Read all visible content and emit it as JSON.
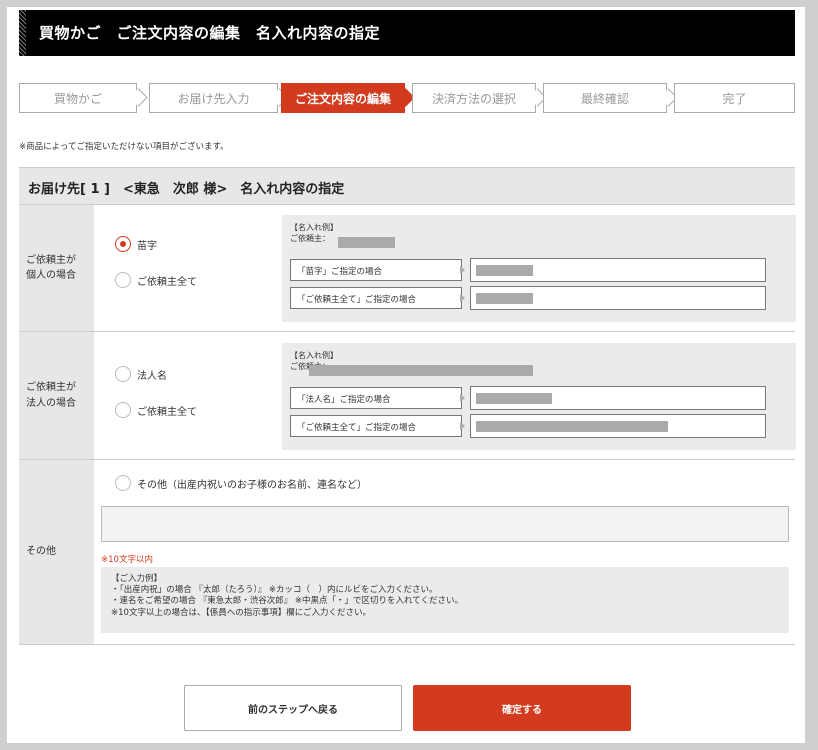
{
  "title": "買物かご　ご注文内容の編集　名入れ内容の指定",
  "steps": [
    "買物かご",
    "お届け先入力",
    "ご注文内容の編集",
    "決済方法の選択",
    "最終確認",
    "完了"
  ],
  "active_step": 2,
  "note": "※商品によってご指定いただけない項目がございます。",
  "section_title": "お届け先[ 1 ]　<東急　次郎 様>　名入れ内容の指定",
  "individual": {
    "label1": "ご依頼主が",
    "label2": "個人の場合",
    "option1": "苗字",
    "option2": "ご依頼主全て",
    "selected": "苗字",
    "example_heading": "【名入れ例】",
    "example_client": "ご依頼主：",
    "field1": "「苗字」ご指定の場合",
    "field2": "「ご依頼主全て」ご指定の場合"
  },
  "corporate": {
    "label1": "ご依頼主が",
    "label2": "法人の場合",
    "option1": "法人名",
    "option2": "ご依頼主全て",
    "example_heading": "【名入れ例】",
    "example_client": "ご依頼主：",
    "field1": "「法人名」ご指定の場合",
    "field2": "「ご依頼主全て」ご指定の場合"
  },
  "other": {
    "label": "その他",
    "option": "その他（出産内祝いのお子様のお名前、連名など）",
    "input_value": "",
    "limit": "※10文字以内",
    "example_heading": "【ご入力例】",
    "example_line1": "・「出産内祝」の場合 『太郎（たろう）』 ※カッコ（　）内にルビをご入力ください。",
    "example_line2": "・連名をご希望の場合 『東急太郎・渋谷次郎』 ※中黒点「・」で区切りを入れてください。",
    "example_line3": "※10文字以上の場合は、【係員への指示事項】欄にご入力ください。"
  },
  "buttons": {
    "back": "前のステップへ戻る",
    "confirm": "確定する"
  },
  "colors": {
    "accent": "#d23b1e",
    "header_bg": "#000000",
    "label_bg": "#e7e7e7"
  }
}
